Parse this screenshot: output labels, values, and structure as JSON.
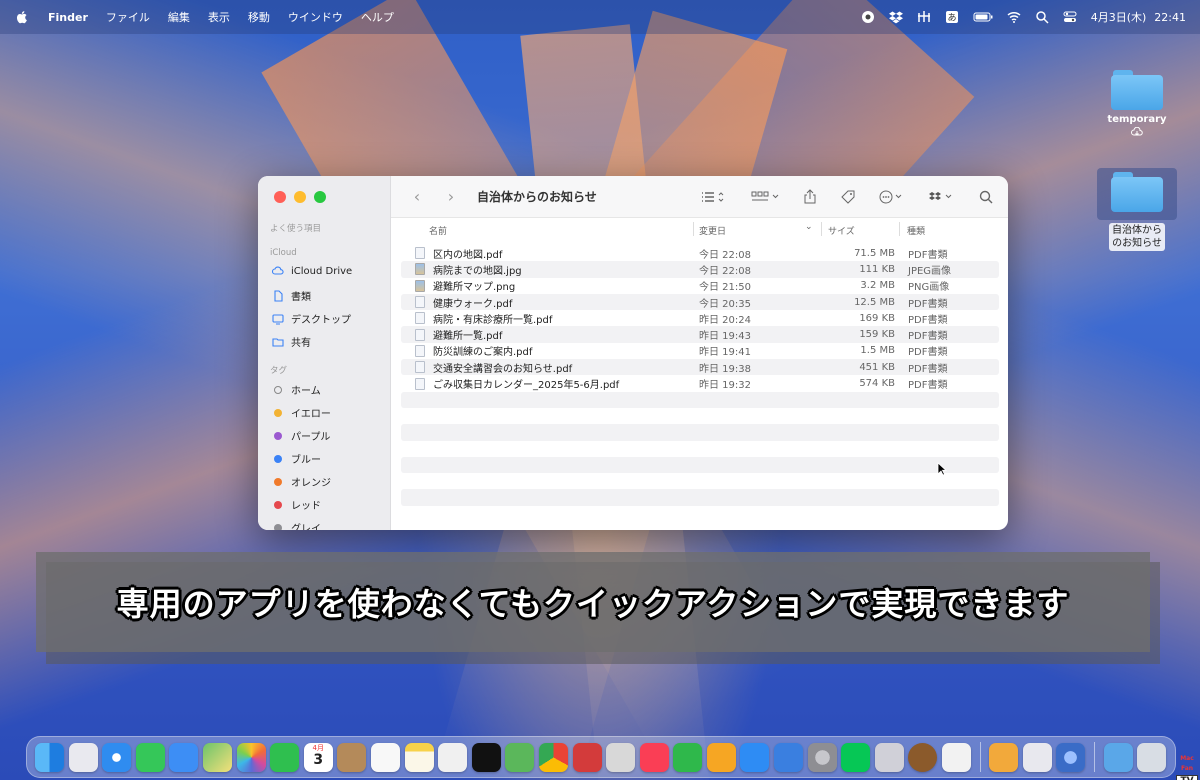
{
  "menubar": {
    "app": "Finder",
    "items": [
      "ファイル",
      "編集",
      "表示",
      "移動",
      "ウインドウ",
      "ヘルプ"
    ],
    "date": "4月3日(木)",
    "time": "22:41"
  },
  "desktop": {
    "icons": [
      {
        "label": "temporary"
      },
      {
        "label": "自治体からのお知らせ"
      }
    ]
  },
  "finder": {
    "title": "自治体からのお知らせ",
    "sidebar": {
      "favorites_header": "よく使う項目",
      "icloud_header": "iCloud",
      "icloud_items": [
        "iCloud Drive",
        "書類",
        "デスクトップ",
        "共有"
      ],
      "tags_header": "タグ",
      "tags": [
        {
          "label": "ホーム",
          "color": "none"
        },
        {
          "label": "イエロー",
          "color": "#f2b233"
        },
        {
          "label": "パープル",
          "color": "#9b59d0"
        },
        {
          "label": "ブルー",
          "color": "#3b82f6"
        },
        {
          "label": "オレンジ",
          "color": "#f07a2b"
        },
        {
          "label": "レッド",
          "color": "#e5484d"
        },
        {
          "label": "グレイ",
          "color": "#8e8e93"
        }
      ]
    },
    "columns": {
      "name": "名前",
      "date": "変更日",
      "size": "サイズ",
      "kind": "種類"
    },
    "files": [
      {
        "name": "区内の地図.pdf",
        "date": "今日 22:08",
        "size": "71.5 MB",
        "kind": "PDF書類",
        "icon": "pdf"
      },
      {
        "name": "病院までの地図.jpg",
        "date": "今日 22:08",
        "size": "111 KB",
        "kind": "JPEG画像",
        "icon": "image"
      },
      {
        "name": "避難所マップ.png",
        "date": "今日 21:50",
        "size": "3.2 MB",
        "kind": "PNG画像",
        "icon": "image"
      },
      {
        "name": "健康ウォーク.pdf",
        "date": "今日 20:35",
        "size": "12.5 MB",
        "kind": "PDF書類",
        "icon": "pdf"
      },
      {
        "name": "病院・有床診療所一覧.pdf",
        "date": "昨日 20:24",
        "size": "169 KB",
        "kind": "PDF書類",
        "icon": "pdf"
      },
      {
        "name": "避難所一覧.pdf",
        "date": "昨日 19:43",
        "size": "159 KB",
        "kind": "PDF書類",
        "icon": "pdf"
      },
      {
        "name": "防災訓練のご案内.pdf",
        "date": "昨日 19:41",
        "size": "1.5 MB",
        "kind": "PDF書類",
        "icon": "pdf"
      },
      {
        "name": "交通安全講習会のお知らせ.pdf",
        "date": "昨日 19:38",
        "size": "451 KB",
        "kind": "PDF書類",
        "icon": "pdf"
      },
      {
        "name": "ごみ収集日カレンダー_2025年5-6月.pdf",
        "date": "昨日 19:32",
        "size": "574 KB",
        "kind": "PDF書類",
        "icon": "pdf"
      }
    ]
  },
  "subtitle": "専用のアプリを使わなくてもクイックアクションで実現できます",
  "dock": {
    "calendar_month": "4月",
    "calendar_day": "3",
    "apps": [
      {
        "name": "finder",
        "color": "#3a9bf0"
      },
      {
        "name": "launchpad",
        "color": "#e8e8ee"
      },
      {
        "name": "safari",
        "color": "#2f8cf0"
      },
      {
        "name": "messages",
        "color": "#35c759"
      },
      {
        "name": "mail",
        "color": "#3d8ef5"
      },
      {
        "name": "maps",
        "color": "#6cc36a"
      },
      {
        "name": "photos",
        "color": "#f4f4f4"
      },
      {
        "name": "facetime",
        "color": "#2fbf4f"
      },
      {
        "name": "calendar",
        "color": "#ffffff"
      },
      {
        "name": "contacts",
        "color": "#b48a5a"
      },
      {
        "name": "reminders",
        "color": "#f8f8f8"
      },
      {
        "name": "notes",
        "color": "#f7d24a"
      },
      {
        "name": "freeform",
        "color": "#f0f0f0"
      },
      {
        "name": "tv",
        "color": "#111111"
      },
      {
        "name": "numbers-like",
        "color": "#5bb75b"
      },
      {
        "name": "chrome",
        "color": "#f1f1f1"
      },
      {
        "name": "photo-booth",
        "color": "#d33b3b"
      },
      {
        "name": "preview",
        "color": "#d8d8d8"
      },
      {
        "name": "music",
        "color": "#fa3e55"
      },
      {
        "name": "numbers",
        "color": "#2fb84b"
      },
      {
        "name": "pages",
        "color": "#f6a623"
      },
      {
        "name": "app-store",
        "color": "#2e8cf4"
      },
      {
        "name": "xcode",
        "color": "#3a7fe0"
      },
      {
        "name": "system-settings",
        "color": "#8e8e93"
      },
      {
        "name": "line",
        "color": "#06c755"
      },
      {
        "name": "iphone-mirroring",
        "color": "#d0d0d8"
      },
      {
        "name": "acorn",
        "color": "#8b5a2b"
      },
      {
        "name": "chatgpt",
        "color": "#f2f2f2"
      },
      {
        "name": "pixelmator",
        "color": "#f2a93b"
      },
      {
        "name": "screen-sharing",
        "color": "#e8e8ee"
      },
      {
        "name": "quicktime",
        "color": "#3a6cc7"
      },
      {
        "name": "downloads",
        "color": "#5aa7e8"
      },
      {
        "name": "trash",
        "color": "#d8dde4"
      }
    ]
  },
  "badge": {
    "top": "Mac Fan",
    "box": "TV"
  }
}
